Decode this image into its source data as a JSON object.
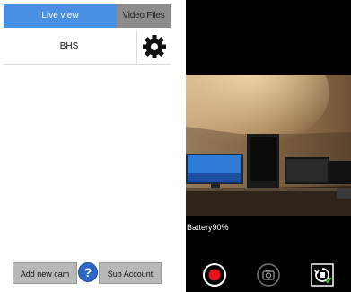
{
  "tabs": {
    "live_view": "Live view",
    "video_files": "Video Files"
  },
  "camera": {
    "name": "BHS"
  },
  "bottom": {
    "add_cam": "Add new cam",
    "help": "?",
    "sub_account": "Sub Account"
  },
  "player": {
    "battery": "Battery90%"
  },
  "icons": {
    "settings": "gear-icon",
    "record": "record-icon",
    "snapshot": "camera-icon",
    "rotate": "rotate-icon"
  },
  "colors": {
    "accent": "#4a90e2",
    "record": "#e8121b",
    "player_bg": "#000000"
  }
}
